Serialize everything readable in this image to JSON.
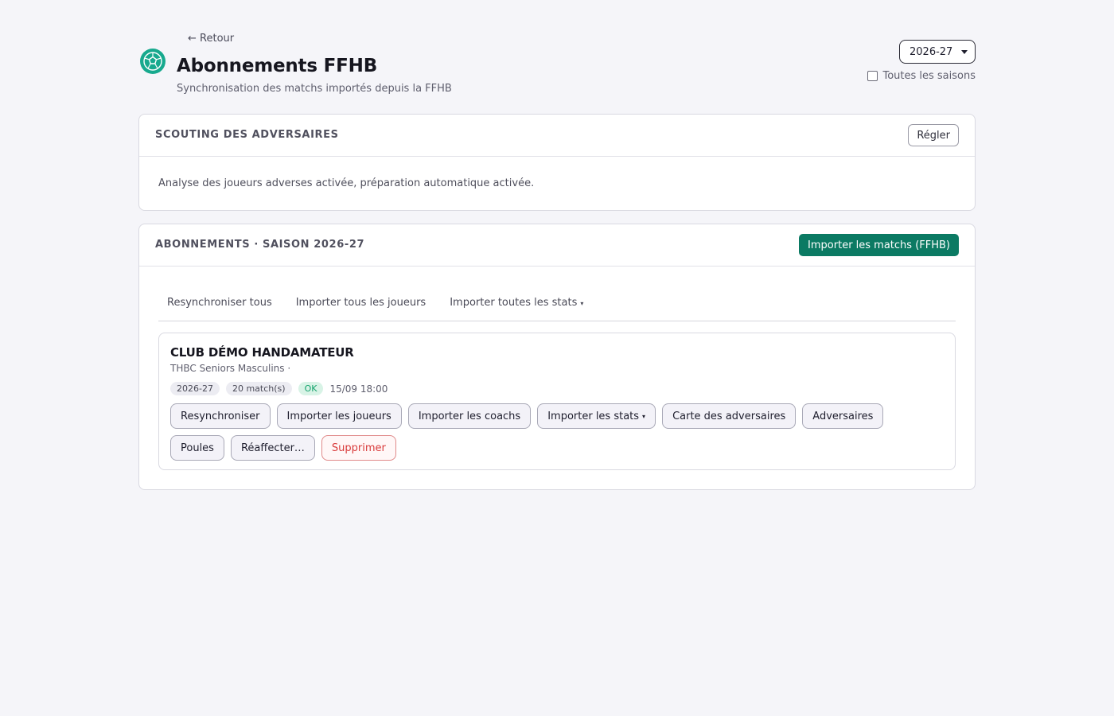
{
  "header": {
    "back_label": "← Retour",
    "title": "Abonnements FFHB",
    "subtitle": "Synchronisation des matchs importés depuis la FFHB",
    "logo_icon": "handball-icon",
    "season_select": {
      "selected": "2026-27"
    },
    "all_seasons_label": "Toutes les saisons"
  },
  "scouting": {
    "title": "SCOUTING DES ADVERSAIRES",
    "settings_label": "Régler",
    "description": "Analyse des joueurs adverses activée, préparation automatique activée."
  },
  "subscriptions": {
    "title": "ABONNEMENTS · SAISON 2026-27",
    "import_button_label": "Importer les matchs (FFHB)",
    "tabs": [
      {
        "label": "Resynchroniser tous"
      },
      {
        "label": "Importer tous les joueurs"
      },
      {
        "label": "Importer toutes les stats",
        "dropdown": "▾"
      }
    ],
    "club": {
      "name": "CLUB DÉMO HANDAMATEUR",
      "team": "THBC Seniors Masculins ·",
      "season_badge": "2026-27",
      "matches_badge": "20 match(s)",
      "status_badge": "OK",
      "last_sync": "15/09 18:00",
      "actions": [
        {
          "label": "Resynchroniser"
        },
        {
          "label": "Importer les joueurs"
        },
        {
          "label": "Importer les coachs"
        },
        {
          "label": "Importer les stats",
          "dropdown": "▾"
        },
        {
          "label": "Carte des adversaires"
        },
        {
          "label": "Adversaires"
        },
        {
          "label": "Poules"
        },
        {
          "label": "Réaffecter…"
        },
        {
          "label": "Supprimer",
          "danger": true
        }
      ]
    }
  },
  "colors": {
    "accent": "#0b7a63",
    "logo": "#17a98e",
    "ok": "#16a36d",
    "danger": "#d93b3b",
    "background": "#f5f5f9"
  }
}
